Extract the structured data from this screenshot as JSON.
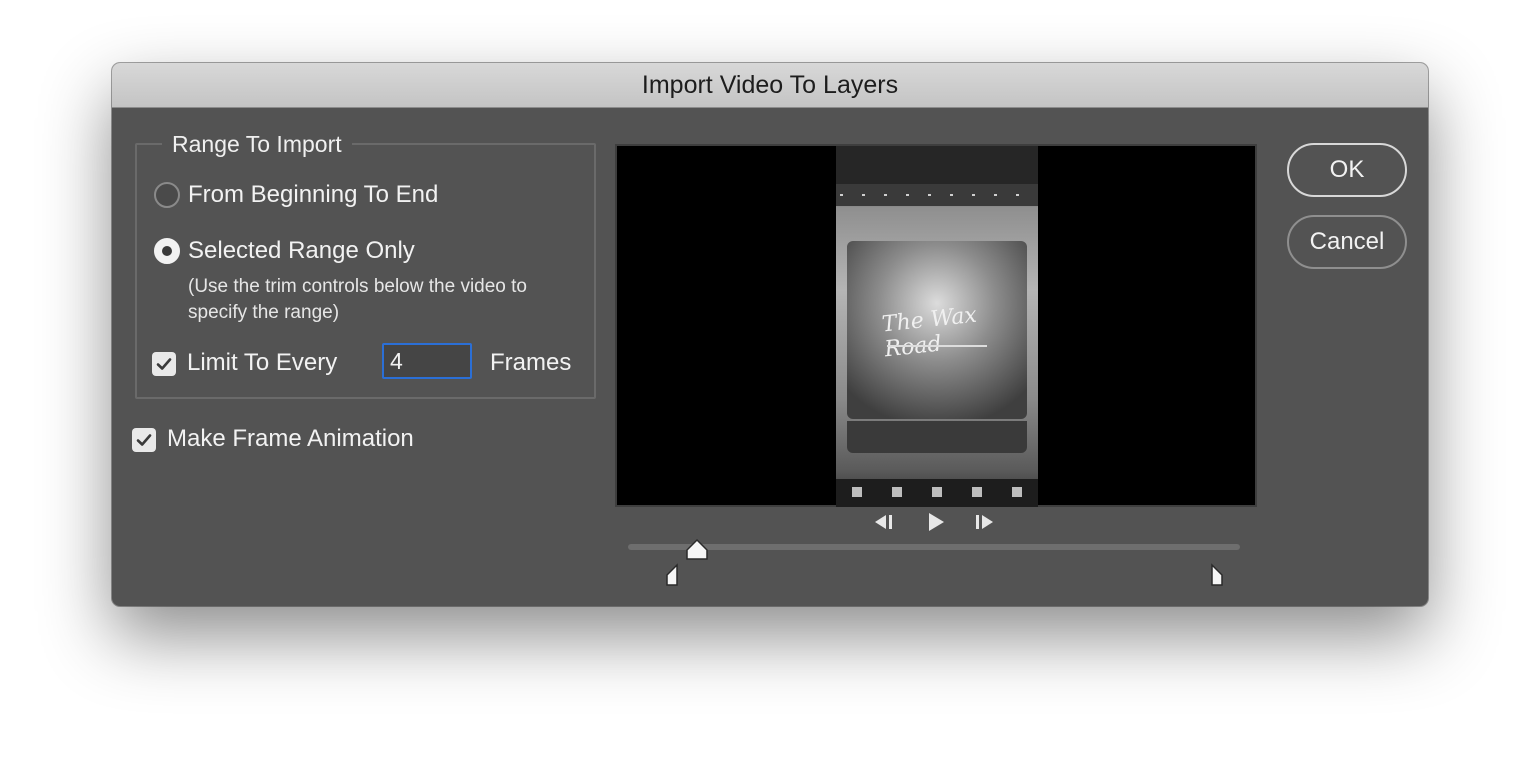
{
  "window": {
    "title": "Import Video To Layers"
  },
  "range": {
    "legend": "Range To Import",
    "option_all": "From Beginning To End",
    "option_selected": "Selected Range Only",
    "selected_hint": "(Use the trim controls below the video to specify the range)",
    "selected_option": "Selected Range Only",
    "limit_label": "Limit To Every",
    "limit_checked": true,
    "limit_value": "4",
    "frames_label": "Frames"
  },
  "animation": {
    "label": "Make Frame Animation",
    "checked": true
  },
  "preview": {
    "album_text": "The Wax Road"
  },
  "playback": {
    "prev_icon": "step-back-icon",
    "play_icon": "play-icon",
    "next_icon": "step-forward-icon",
    "playhead_position": 0.11,
    "trim_start": 0.07,
    "trim_end": 0.96
  },
  "buttons": {
    "ok": "OK",
    "cancel": "Cancel"
  },
  "colors": {
    "focus": "#2b6fd6",
    "dialog_bg": "#535353"
  }
}
